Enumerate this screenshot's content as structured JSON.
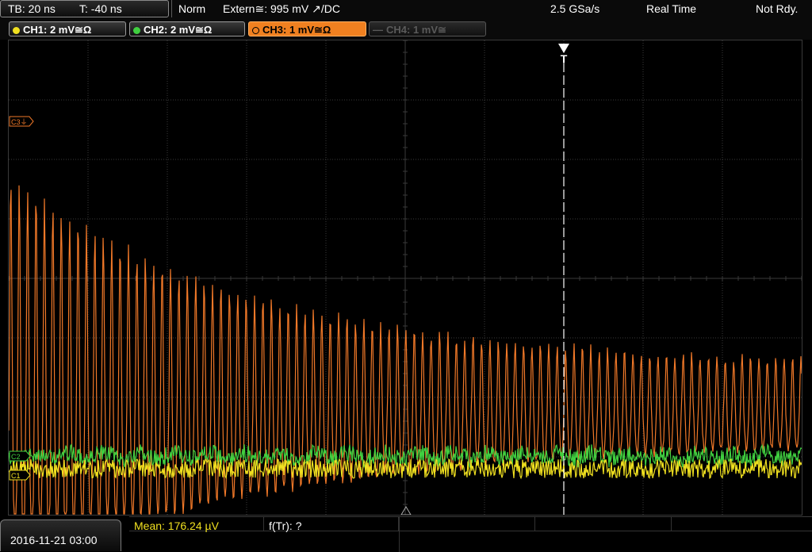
{
  "status": {
    "timebase": "TB: 20 ns",
    "trigger_time": "T: -40 ns",
    "trigger_mode": "Norm",
    "trigger_source": "Extern≅: 995 mV ↗/DC",
    "sample_rate": "2.5 GSa/s",
    "acq_mode": "Real Time",
    "run_state": "Not Rdy."
  },
  "channels": [
    {
      "label": "CH1: 2 mV≅Ω",
      "color": "#f0e020",
      "state": "on"
    },
    {
      "label": "CH2: 2 mV≅Ω",
      "color": "#40d040",
      "state": "on"
    },
    {
      "label": "CH3: 1 mV≅Ω",
      "color": "#f08020",
      "state": "active"
    },
    {
      "label": "CH4: 1 mV≅",
      "color": "#5a5a5a",
      "state": "off"
    }
  ],
  "markers": {
    "trigger": "T",
    "ch3_ref": "C3⏚",
    "ch2_ref": "C2",
    "ch1_ref": "C1"
  },
  "colors": {
    "grid": "#3a3a3a",
    "ch1": "#f0e020",
    "ch2": "#40d040",
    "ch3": "#f07828",
    "trigger_line": "#ffffff"
  },
  "bottom": {
    "date": "2016-11-21 03:00",
    "mean_label": "Mean: 176.24 µV",
    "freq_label": "f(Tr): ?"
  }
}
